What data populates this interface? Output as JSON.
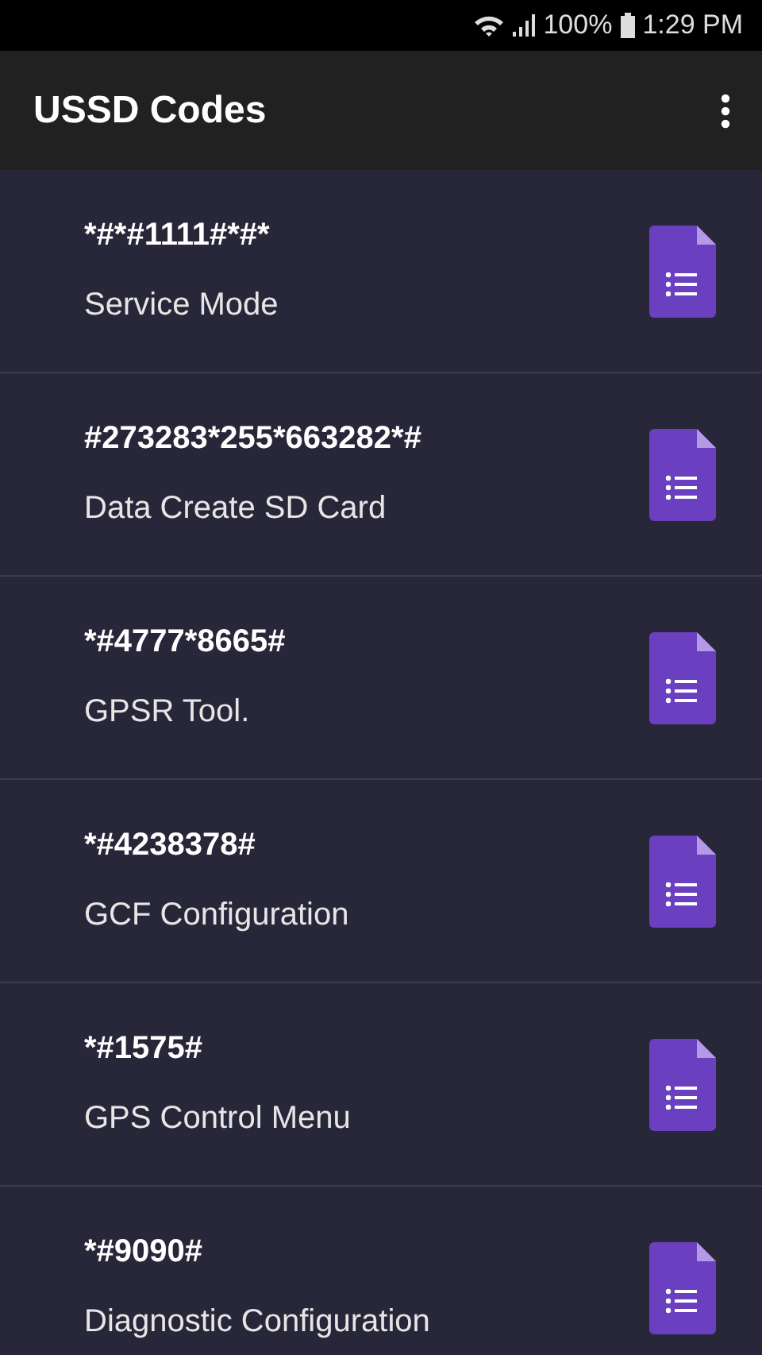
{
  "status_bar": {
    "battery": "100%",
    "time": "1:29 PM"
  },
  "app_bar": {
    "title": "USSD Codes"
  },
  "codes": [
    {
      "code": "*#*#1111#*#*",
      "name": "Service Mode"
    },
    {
      "code": "#273283*255*663282*#",
      "name": "Data Create SD Card"
    },
    {
      "code": "*#4777*8665#",
      "name": "GPSR Tool."
    },
    {
      "code": "*#4238378#",
      "name": "GCF Configuration"
    },
    {
      "code": "*#1575#",
      "name": "GPS Control Menu"
    },
    {
      "code": "*#9090#",
      "name": "Diagnostic Configuration"
    }
  ]
}
